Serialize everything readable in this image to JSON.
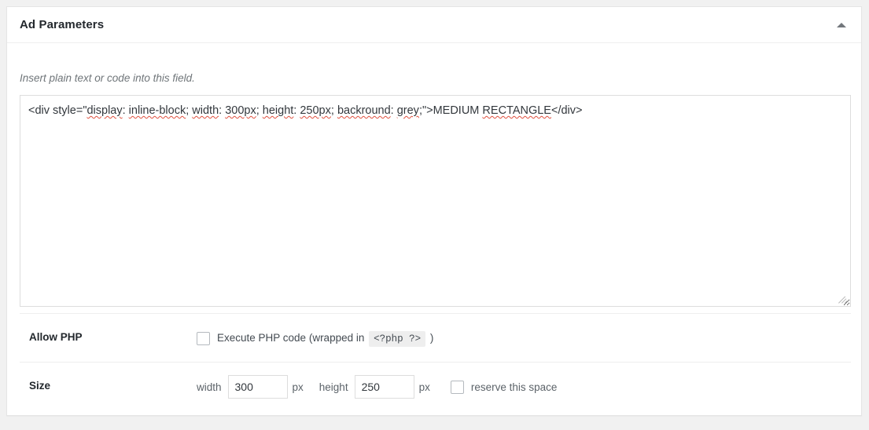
{
  "panel": {
    "title": "Ad Parameters",
    "toggle_icon": "caret-up-icon",
    "hint": "Insert plain text or code into this field."
  },
  "code_field": {
    "name": "ad-parameters-textarea",
    "value": "<div style=\"display: inline-block; width: 300px; height: 250px; backround: grey;\">MEDIUM RECTANGLE</div>",
    "segments": [
      {
        "text": "<div style=\"",
        "misspelled": false
      },
      {
        "text": "display",
        "misspelled": true
      },
      {
        "text": ": ",
        "misspelled": false
      },
      {
        "text": "inline-block",
        "misspelled": true
      },
      {
        "text": "; ",
        "misspelled": false
      },
      {
        "text": "width",
        "misspelled": true
      },
      {
        "text": ": ",
        "misspelled": false
      },
      {
        "text": "300px",
        "misspelled": true
      },
      {
        "text": "; ",
        "misspelled": false
      },
      {
        "text": "height",
        "misspelled": true
      },
      {
        "text": ": ",
        "misspelled": false
      },
      {
        "text": "250px",
        "misspelled": true
      },
      {
        "text": "; ",
        "misspelled": false
      },
      {
        "text": "backround",
        "misspelled": true
      },
      {
        "text": ": ",
        "misspelled": false
      },
      {
        "text": "grey",
        "misspelled": true
      },
      {
        "text": ";\">MEDIUM ",
        "misspelled": false
      },
      {
        "text": "RECTANGLE",
        "misspelled": true
      },
      {
        "text": "</div>",
        "misspelled": false
      }
    ],
    "resize_handle": "resize-grip-icon"
  },
  "rows": {
    "allow_php": {
      "label": "Allow PHP",
      "checkbox_checked": false,
      "text_before": "Execute PHP code (wrapped in",
      "code_tag": "<?php ?>",
      "text_after": ")"
    },
    "size": {
      "label": "Size",
      "width_label": "width",
      "width_value": "300",
      "width_unit": "px",
      "height_label": "height",
      "height_value": "250",
      "height_unit": "px",
      "reserve_checked": false,
      "reserve_label": "reserve this space"
    }
  },
  "colors": {
    "page_bg": "#f1f1f1",
    "panel_bg": "#ffffff",
    "panel_border": "#e5e5e5",
    "title": "#23282d",
    "hint": "#6f7579",
    "spellcheck_underline": "#e04f3e"
  }
}
